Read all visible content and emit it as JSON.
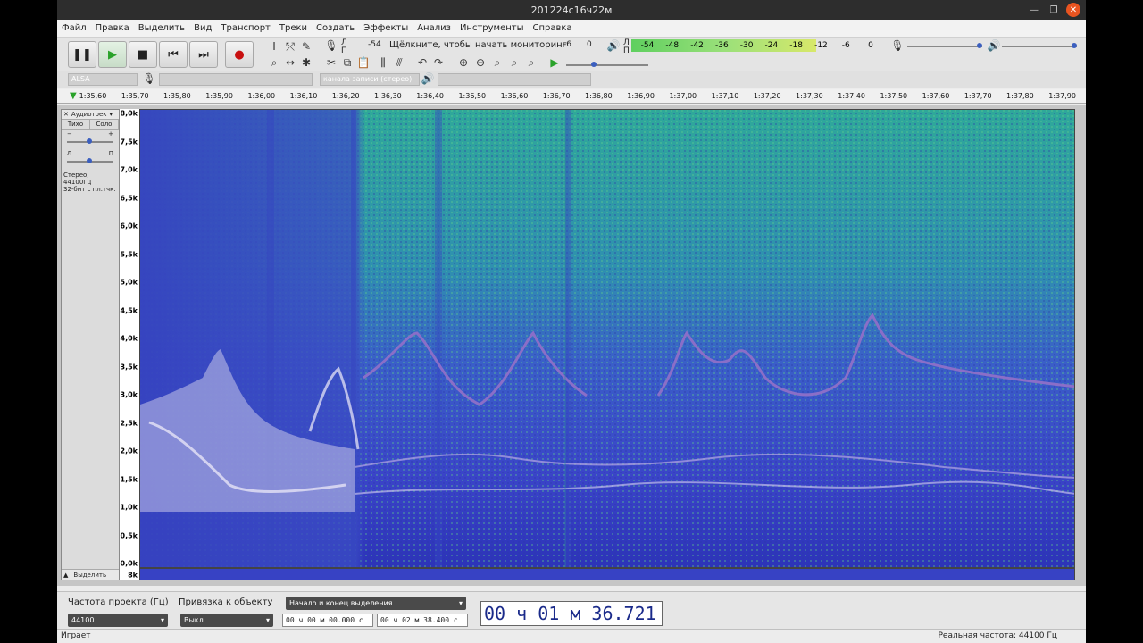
{
  "window": {
    "title": "201224с16ч22м"
  },
  "menu": [
    "Файл",
    "Правка",
    "Выделить",
    "Вид",
    "Транспорт",
    "Треки",
    "Создать",
    "Эффекты",
    "Анализ",
    "Инструменты",
    "Справка"
  ],
  "meters": {
    "rec_label_L": "Л",
    "rec_label_R": "П",
    "rec_monitor_text": "Щёлкните, чтобы начать мониторинг",
    "rec_start": "-54",
    "rec_ticks": [
      "-6",
      "0"
    ],
    "play_ticks": [
      "-54",
      "-48",
      "-42",
      "-36",
      "-30",
      "-24",
      "-18",
      "-12",
      "-6",
      "0"
    ],
    "play_level_percent": 74
  },
  "devices": {
    "host": "ALSA",
    "channels": "канала записи (стерео)"
  },
  "ruler": [
    "1:35,60",
    "1:35,70",
    "1:35,80",
    "1:35,90",
    "1:36,00",
    "1:36,10",
    "1:36,20",
    "1:36,30",
    "1:36,40",
    "1:36,50",
    "1:36,60",
    "1:36,70",
    "1:36,80",
    "1:36,90",
    "1:37,00",
    "1:37,10",
    "1:37,20",
    "1:37,30",
    "1:37,40",
    "1:37,50",
    "1:37,60",
    "1:37,70",
    "1:37,80",
    "1:37,90"
  ],
  "track": {
    "name": "Аудиотрек",
    "mute": "Тихо",
    "solo": "Соло",
    "gain_minus": "−",
    "gain_plus": "+",
    "pan_left": "Л",
    "pan_right": "П",
    "info_line1": "Стерео, 44100Гц",
    "info_line2": "32-бит с пл.тчк.",
    "select": "Выделить"
  },
  "yaxis": [
    "8,0k",
    "7,5k",
    "7,0k",
    "6,5k",
    "6,0k",
    "5,5k",
    "5,0k",
    "4,5k",
    "4,0k",
    "3,5k",
    "3,0k",
    "2,5k",
    "2,0k",
    "1,5k",
    "1,0k",
    "0,5k",
    "0,0k"
  ],
  "yaxis_bottom": "8k",
  "selection": {
    "rate_label": "Частота проекта (Гц)",
    "rate_value": "44100",
    "snap_label": "Привязка к объекту",
    "snap_value": "Выкл",
    "mode": "Начало и конец выделения",
    "start": "00 ч 00 м 00.000 с",
    "end": "00 ч 02 м 38.400 с",
    "time": "00 ч 01 м 36.721 с"
  },
  "status": {
    "left": "Играет",
    "right": "Реальная частота: 44100 Гц"
  }
}
